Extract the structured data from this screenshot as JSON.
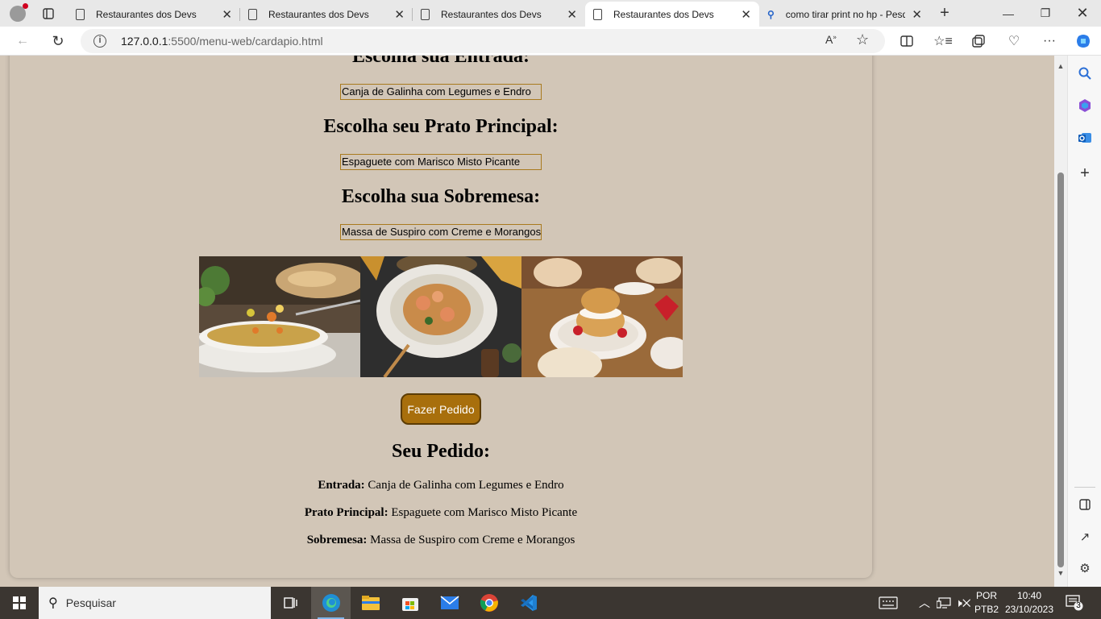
{
  "tabs": [
    {
      "label": "Restaurantes dos Devs",
      "active": false
    },
    {
      "label": "Restaurantes dos Devs",
      "active": false
    },
    {
      "label": "Restaurantes dos Devs",
      "active": false
    },
    {
      "label": "Restaurantes dos Devs",
      "active": true
    },
    {
      "label": "como tirar print no hp - Pesq",
      "active": false
    }
  ],
  "address": {
    "host": "127.0.0.1",
    "path": ":5500/menu-web/cardapio.html"
  },
  "page": {
    "heading_entrada": "Escolha sua Entrada:",
    "select_entrada": "Canja de Galinha com Legumes e Endro",
    "heading_principal": "Escolha seu Prato Principal:",
    "select_principal": "Espaguete com Marisco Misto Picante",
    "heading_sobremesa": "Escolha sua Sobremesa:",
    "select_sobremesa": "Massa de Suspiro com Creme e Morangos",
    "order_button": "Fazer Pedido",
    "summary_title": "Seu Pedido:",
    "summary": {
      "entrada_label": "Entrada:",
      "entrada_value": "Canja de Galinha com Legumes e Endro",
      "principal_label": "Prato Principal:",
      "principal_value": "Espaguete com Marisco Misto Picante",
      "sobremesa_label": "Sobremesa:",
      "sobremesa_value": "Massa de Suspiro com Creme e Morangos"
    }
  },
  "taskbar": {
    "search_placeholder": "Pesquisar",
    "lang_line1": "POR",
    "lang_line2": "PTB2",
    "time": "10:40",
    "date": "23/10/2023",
    "notification_count": "3"
  },
  "colors": {
    "page_bg": "#d2c6b7",
    "button_bg": "#a86f0c",
    "select_border": "#a97a1e"
  }
}
